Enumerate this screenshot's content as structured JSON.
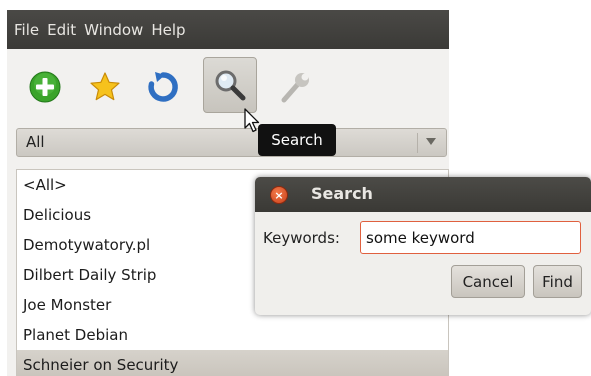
{
  "menu": [
    "File",
    "Edit",
    "Window",
    "Help"
  ],
  "toolbar": {
    "icons": [
      "add-icon",
      "star-icon",
      "refresh-icon",
      "search-icon",
      "wrench-icon"
    ],
    "active": "search-icon"
  },
  "tooltip": "Search",
  "filter": {
    "selected": "All"
  },
  "feeds": [
    "<All>",
    "Delicious",
    "Demotywatory.pl",
    "Dilbert Daily Strip",
    "Joe Monster",
    "Planet Debian",
    "Schneier on Security"
  ],
  "selected_feed": "Schneier on Security",
  "dialog": {
    "title": "Search",
    "keywords_label": "Keywords:",
    "keywords_value": "some keyword",
    "cancel_label": "Cancel",
    "find_label": "Find"
  },
  "colors": {
    "menubar": "#3f3e3b",
    "accent_orange": "#e0603f",
    "add_green": "#3aa32a",
    "refresh_blue": "#2f6fc2"
  }
}
